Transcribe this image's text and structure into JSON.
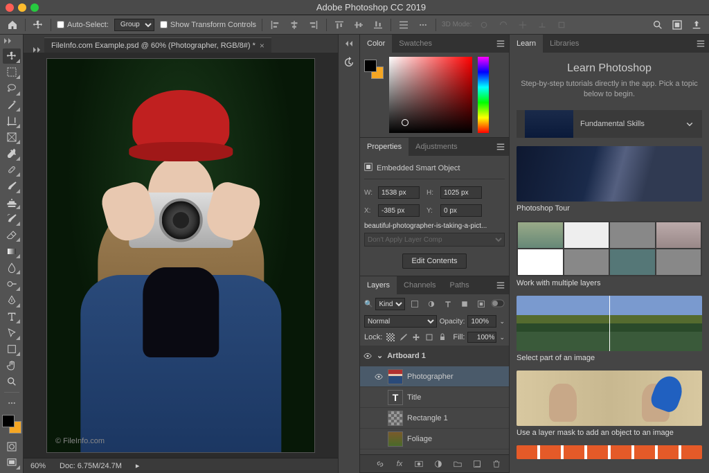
{
  "app": {
    "title": "Adobe Photoshop CC 2019"
  },
  "optionbar": {
    "auto_select": "Auto-Select:",
    "group": "Group",
    "show_transform": "Show Transform Controls",
    "mode_3d": "3D Mode:"
  },
  "document": {
    "tab_title": "FileInfo.com Example.psd @ 60% (Photographer, RGB/8#) *",
    "artboard_label": "Artboard 1",
    "watermark": "© FileInfo.com",
    "zoom": "60%",
    "doc_info": "Doc: 6.75M/24.7M"
  },
  "panels": {
    "color": {
      "tab_color": "Color",
      "tab_swatches": "Swatches"
    },
    "properties": {
      "tab_properties": "Properties",
      "tab_adjustments": "Adjustments",
      "object_type": "Embedded Smart Object",
      "w_label": "W:",
      "w_value": "1538 px",
      "h_label": "H:",
      "h_value": "1025 px",
      "x_label": "X:",
      "x_value": "-385 px",
      "y_label": "Y:",
      "y_value": "0 px",
      "filename": "beautiful-photographer-is-taking-a-pict...",
      "layer_comp_placeholder": "Don't Apply Layer Comp",
      "edit_contents": "Edit Contents"
    },
    "layers": {
      "tab_layers": "Layers",
      "tab_channels": "Channels",
      "tab_paths": "Paths",
      "kind": "Kind",
      "blend_mode": "Normal",
      "opacity_label": "Opacity:",
      "opacity_value": "100%",
      "lock_label": "Lock:",
      "fill_label": "Fill:",
      "fill_value": "100%",
      "items": [
        {
          "name": "Artboard 1",
          "type": "artboard"
        },
        {
          "name": "Photographer",
          "type": "smart"
        },
        {
          "name": "Title",
          "type": "text"
        },
        {
          "name": "Rectangle 1",
          "type": "shape"
        },
        {
          "name": "Foliage",
          "type": "smart"
        }
      ]
    }
  },
  "learn": {
    "tab_learn": "Learn",
    "tab_libraries": "Libraries",
    "title": "Learn Photoshop",
    "subtitle": "Step-by-step tutorials directly in the app. Pick a topic below to begin.",
    "section": "Fundamental Skills",
    "tutorials": [
      {
        "caption": "Photoshop Tour"
      },
      {
        "caption": "Work with multiple layers"
      },
      {
        "caption": "Select part of an image"
      },
      {
        "caption": "Use a layer mask to add an object to an image"
      }
    ]
  }
}
